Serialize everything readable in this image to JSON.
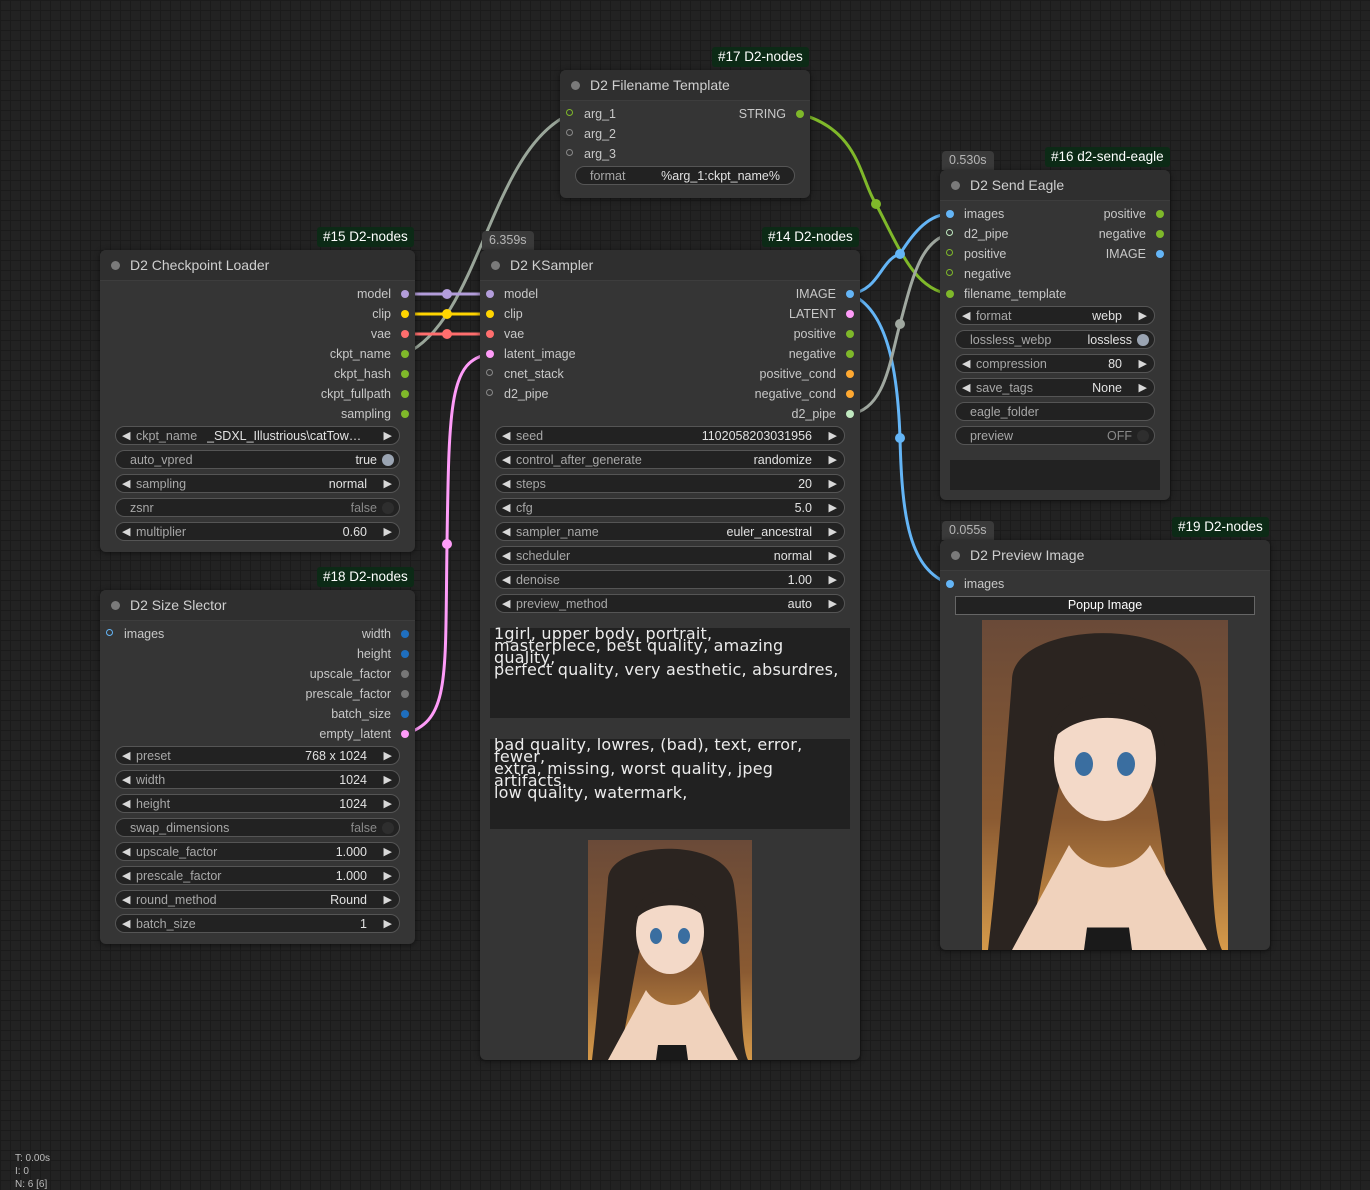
{
  "status": {
    "t": "T: 0.00s",
    "i": "I: 0",
    "n": "N: 6 [6]"
  },
  "colors": {
    "model": "#b39ddb",
    "clip": "#ffd500",
    "vae": "#ff6e6e",
    "latent": "#ff9cf9",
    "image": "#64b5f6",
    "string": "#7fb82a",
    "pipe": "#a0a8a0",
    "cond": "#ffa931",
    "int": "#1f6fbf"
  },
  "nodes": {
    "filename_template": {
      "badge": "#17 D2-nodes",
      "title": "D2 Filename Template",
      "inputs": [
        "arg_1",
        "arg_2",
        "arg_3"
      ],
      "outputs": [
        "STRING"
      ],
      "format_label": "format",
      "format_value": "%arg_1:ckpt_name%"
    },
    "checkpoint_loader": {
      "badge": "#15 D2-nodes",
      "title": "D2 Checkpoint Loader",
      "outputs": [
        "model",
        "clip",
        "vae",
        "ckpt_name",
        "ckpt_hash",
        "ckpt_fullpath",
        "sampling"
      ],
      "widgets": [
        {
          "label": "ckpt_name",
          "value": "_SDXL_Illustrious\\catTower..."
        },
        {
          "label": "auto_vpred",
          "value": "true"
        },
        {
          "label": "sampling",
          "value": "normal"
        },
        {
          "label": "zsnr",
          "value": "false"
        },
        {
          "label": "multiplier",
          "value": "0.60"
        }
      ]
    },
    "size_selector": {
      "badge": "#18 D2-nodes",
      "title": "D2 Size Slector",
      "inputs": [
        "images"
      ],
      "outputs": [
        "width",
        "height",
        "upscale_factor",
        "prescale_factor",
        "batch_size",
        "empty_latent"
      ],
      "widgets": [
        {
          "label": "preset",
          "value": "768 x 1024"
        },
        {
          "label": "width",
          "value": "1024"
        },
        {
          "label": "height",
          "value": "1024"
        },
        {
          "label": "swap_dimensions",
          "value": "false"
        },
        {
          "label": "upscale_factor",
          "value": "1.000"
        },
        {
          "label": "prescale_factor",
          "value": "1.000"
        },
        {
          "label": "round_method",
          "value": "Round"
        },
        {
          "label": "batch_size",
          "value": "1"
        }
      ]
    },
    "ksampler": {
      "badge": "#14 D2-nodes",
      "time": "6.359s",
      "title": "D2 KSampler",
      "inputs": [
        "model",
        "clip",
        "vae",
        "latent_image",
        "cnet_stack",
        "d2_pipe"
      ],
      "outputs": [
        "IMAGE",
        "LATENT",
        "positive",
        "negative",
        "positive_cond",
        "negative_cond",
        "d2_pipe"
      ],
      "widgets": [
        {
          "label": "seed",
          "value": "1102058203031956"
        },
        {
          "label": "control_after_generate",
          "value": "randomize"
        },
        {
          "label": "steps",
          "value": "20"
        },
        {
          "label": "cfg",
          "value": "5.0"
        },
        {
          "label": "sampler_name",
          "value": "euler_ancestral"
        },
        {
          "label": "scheduler",
          "value": "normal"
        },
        {
          "label": "denoise",
          "value": "1.00"
        },
        {
          "label": "preview_method",
          "value": "auto"
        }
      ],
      "positive_prompt": "1girl, upper body, portrait,\nmasterpiece, best quality, amazing quality,\nperfect quality, very aesthetic, absurdres,",
      "negative_prompt": "bad quality, lowres, (bad), text, error, fewer,\nextra, missing, worst quality, jpeg artifacts,\nlow quality, watermark,"
    },
    "send_eagle": {
      "badge": "#16 d2-send-eagle",
      "time": "0.530s",
      "title": "D2 Send Eagle",
      "inputs": [
        "images",
        "d2_pipe",
        "positive",
        "negative",
        "filename_template"
      ],
      "outputs": [
        "positive",
        "negative",
        "IMAGE"
      ],
      "widgets": [
        {
          "label": "format",
          "value": "webp"
        },
        {
          "label": "lossless_webp",
          "value": "lossless"
        },
        {
          "label": "compression",
          "value": "80"
        },
        {
          "label": "save_tags",
          "value": "None"
        },
        {
          "label": "eagle_folder",
          "value": ""
        },
        {
          "label": "preview",
          "value": "OFF"
        }
      ]
    },
    "preview_image": {
      "badge": "#19 D2-nodes",
      "time": "0.055s",
      "title": "D2 Preview Image",
      "inputs": [
        "images"
      ],
      "button": "Popup Image"
    }
  }
}
